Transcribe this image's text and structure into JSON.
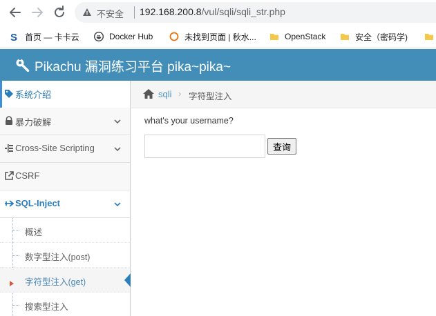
{
  "browser": {
    "insecure_label": "不安全",
    "url_host": "192.168.200.8",
    "url_path": "/vul/sqli/sqli_str.php"
  },
  "bookmarks": [
    {
      "label": "首页 — 卡卡云",
      "icon": "s-logo-icon"
    },
    {
      "label": "Docker Hub",
      "icon": "docker-icon"
    },
    {
      "label": "未找到页面 | 秋水...",
      "icon": "circle-icon"
    },
    {
      "label": "OpenStack",
      "icon": "folder-icon"
    },
    {
      "label": "安全（密码学)",
      "icon": "folder-icon"
    }
  ],
  "header": {
    "title": "Pikachu 漏洞练习平台 pika~pika~"
  },
  "sidebar": {
    "items": [
      {
        "label": "系统介绍",
        "icon": "tag-icon"
      },
      {
        "label": "暴力破解",
        "icon": "lock-icon"
      },
      {
        "label": "Cross-Site Scripting",
        "icon": "list-icon"
      },
      {
        "label": "CSRF",
        "icon": "external-icon"
      },
      {
        "label": "SQL-Inject",
        "icon": "plane-icon"
      }
    ],
    "sub_items": [
      {
        "label": "概述"
      },
      {
        "label": "数字型注入(post)"
      },
      {
        "label": "字符型注入(get)"
      },
      {
        "label": "搜索型注入"
      }
    ]
  },
  "breadcrumb": {
    "link": "sqli",
    "current": "字符型注入"
  },
  "form": {
    "question": "what's your username?",
    "input_value": "",
    "submit_label": "查询"
  },
  "colors": {
    "header_bg": "#438eb9",
    "accent": "#2b7dbc",
    "active_marker": "#d15b47"
  }
}
